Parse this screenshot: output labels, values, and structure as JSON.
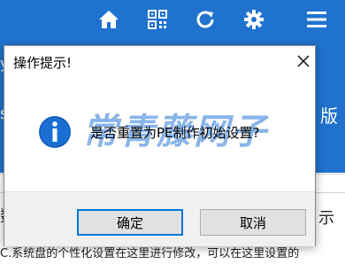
{
  "toolbar": {
    "icons": [
      "home-icon",
      "qr-code-icon",
      "refresh-icon",
      "settings-icon",
      "menu-icon"
    ],
    "accent": "#1f73cf"
  },
  "background": {
    "left_edge_text": "y",
    "left_edge_text2": "s",
    "right_edge_text": "版",
    "right_edge_text2": "示",
    "left_edge_text3": "数",
    "bottom_text": "C.系统盘的个性化设置在这里进行修改，可以在这里设置的"
  },
  "dialog": {
    "title": "操作提示!",
    "message": "是否重置为PE制作初始设置?",
    "watermark": "常青藤网子",
    "ok_label": "确定",
    "cancel_label": "取消"
  }
}
